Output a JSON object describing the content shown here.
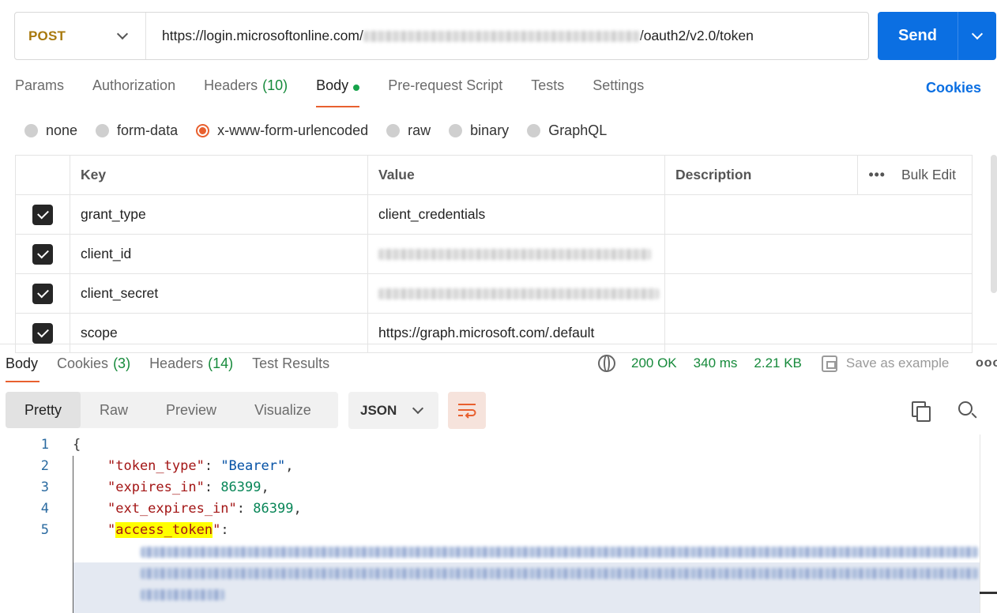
{
  "request": {
    "method": "POST",
    "url_prefix": "https://login.microsoftonline.com/",
    "url_suffix": "/oauth2/v2.0/token",
    "send_label": "Send"
  },
  "request_tabs": [
    {
      "label": "Params"
    },
    {
      "label": "Authorization"
    },
    {
      "label": "Headers",
      "count": "(10)"
    },
    {
      "label": "Body"
    },
    {
      "label": "Pre-request Script"
    },
    {
      "label": "Tests"
    },
    {
      "label": "Settings"
    }
  ],
  "cookies_link": "Cookies",
  "body_types": [
    "none",
    "form-data",
    "x-www-form-urlencoded",
    "raw",
    "binary",
    "GraphQL"
  ],
  "params_table": {
    "headers": {
      "key": "Key",
      "value": "Value",
      "description": "Description",
      "bulk_edit": "Bulk Edit",
      "more": "•••"
    },
    "rows": [
      {
        "key": "grant_type",
        "value": "client_credentials"
      },
      {
        "key": "client_id",
        "value": ""
      },
      {
        "key": "client_secret",
        "value": ""
      },
      {
        "key": "scope",
        "value": "https://graph.microsoft.com/.default"
      }
    ]
  },
  "response_tabs": [
    {
      "label": "Body"
    },
    {
      "label": "Cookies",
      "count": "(3)"
    },
    {
      "label": "Headers",
      "count": "(14)"
    },
    {
      "label": "Test Results"
    }
  ],
  "response_status": {
    "status": "200 OK",
    "time": "340 ms",
    "size": "2.21 KB",
    "save_example": "Save as example",
    "more": "ooo"
  },
  "view_modes": [
    "Pretty",
    "Raw",
    "Preview",
    "Visualize"
  ],
  "format": "JSON",
  "code": {
    "line_numbers": [
      "1",
      "2",
      "3",
      "4",
      "5"
    ],
    "open_brace": "{",
    "token_type_key": "\"token_type\"",
    "token_type_val": "\"Bearer\"",
    "expires_in_key": "\"expires_in\"",
    "expires_in_val": "86399",
    "ext_expires_in_key": "\"ext_expires_in\"",
    "ext_expires_in_val": "86399",
    "access_token_key": "access_token",
    "colon": ": ",
    "comma": ",",
    "quote": "\""
  },
  "colors": {
    "accent": "#e8602f",
    "send": "#0b6fe2",
    "status_green": "#168a3b",
    "method": "#a8790d",
    "highlight": "#ffff00"
  }
}
